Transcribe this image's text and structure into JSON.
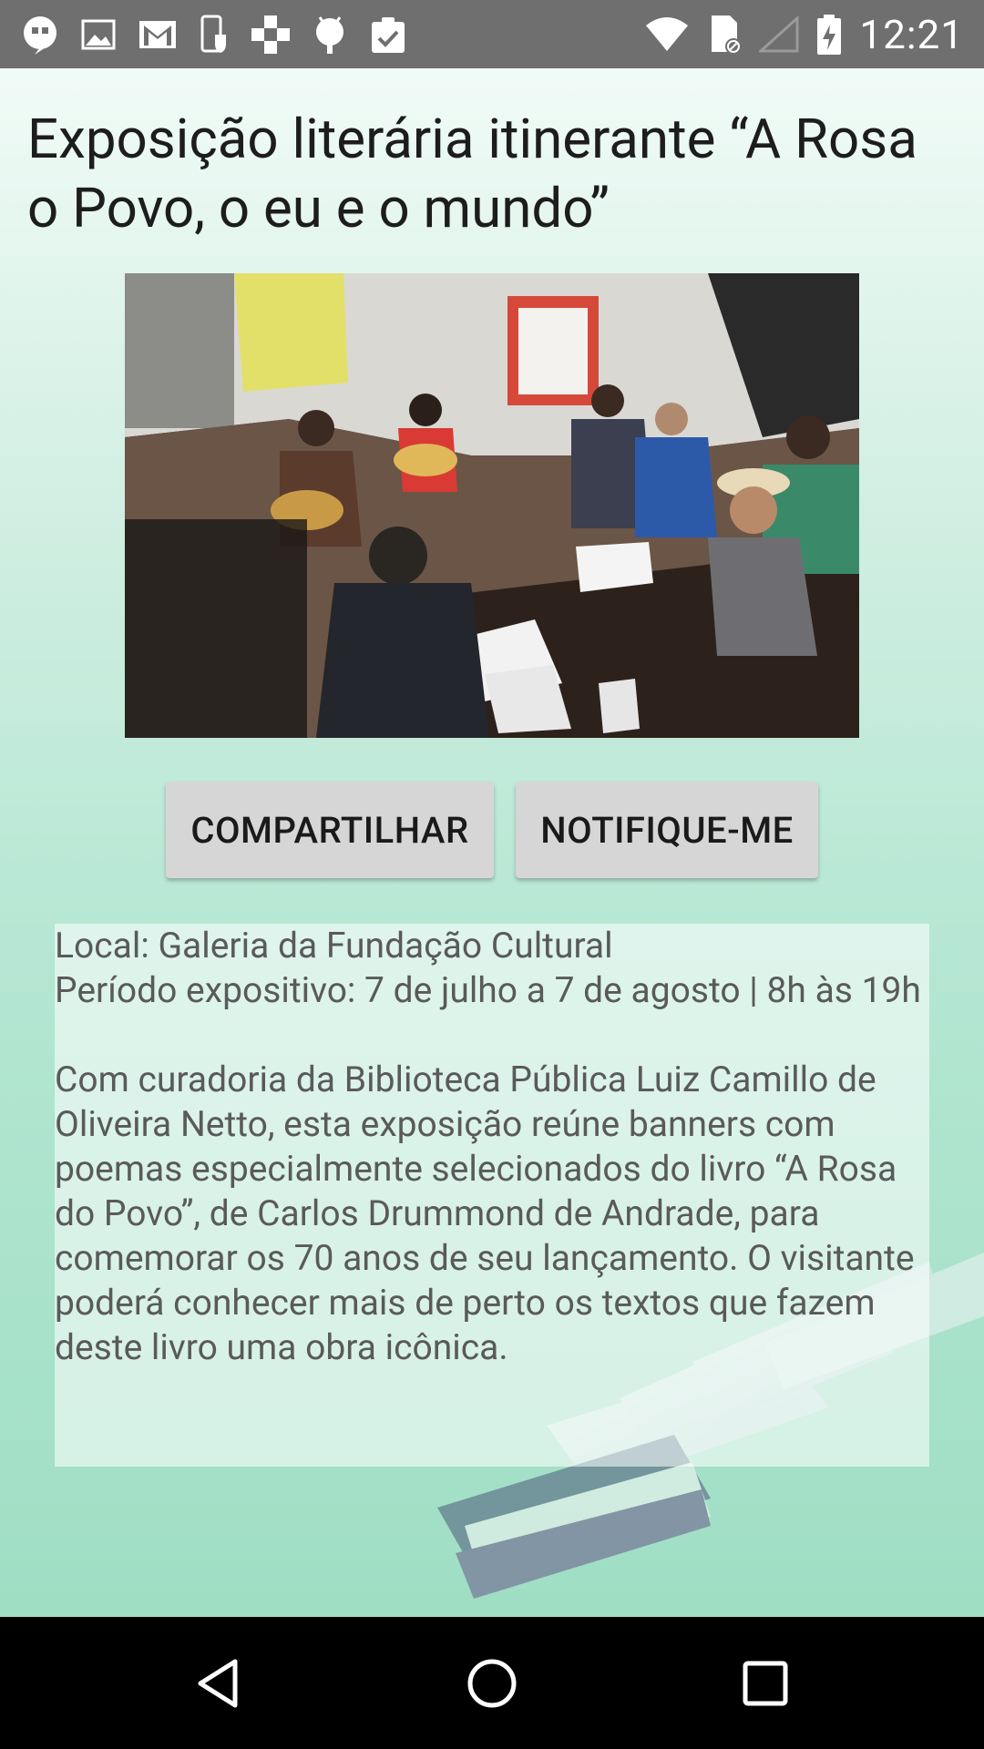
{
  "status_bar": {
    "time": "12:21",
    "left_icons": [
      "hangouts-icon",
      "image-icon",
      "gmail-icon",
      "phone-shield-icon",
      "plus-cross-icon",
      "android-icon",
      "clipboard-check-icon"
    ],
    "right_icons": [
      "wifi-icon",
      "sim-card-icon",
      "signal-icon",
      "battery-icon"
    ]
  },
  "event": {
    "title": "Exposição literária itinerante “A Rosa o Povo, o eu e o mundo”",
    "share_label": "COMPARTILHAR",
    "notify_label": "NOTIFIQUE-ME",
    "location_line": "Local: Galeria da Fundação Cultural",
    "period_line": "Período expositivo: 7 de julho a 7 de agosto | 8h às 19h",
    "description": "Com curadoria da Biblioteca Pública Luiz Camillo de Oliveira Netto, esta exposição reúne banners com poemas especialmente selecionados do livro “A Rosa do Povo”, de Carlos Drummond de Andrade, para comemorar os 70 anos de seu lançamento. O visitante poderá conhecer mais de perto os textos que fazem deste livro uma obra icônica."
  },
  "colors": {
    "status_bar": "#6f6f6f",
    "background_top": "#f1fbf7",
    "background_bottom": "#9fdec4",
    "button": "#d6d6d6",
    "nav_bar": "#000000"
  }
}
